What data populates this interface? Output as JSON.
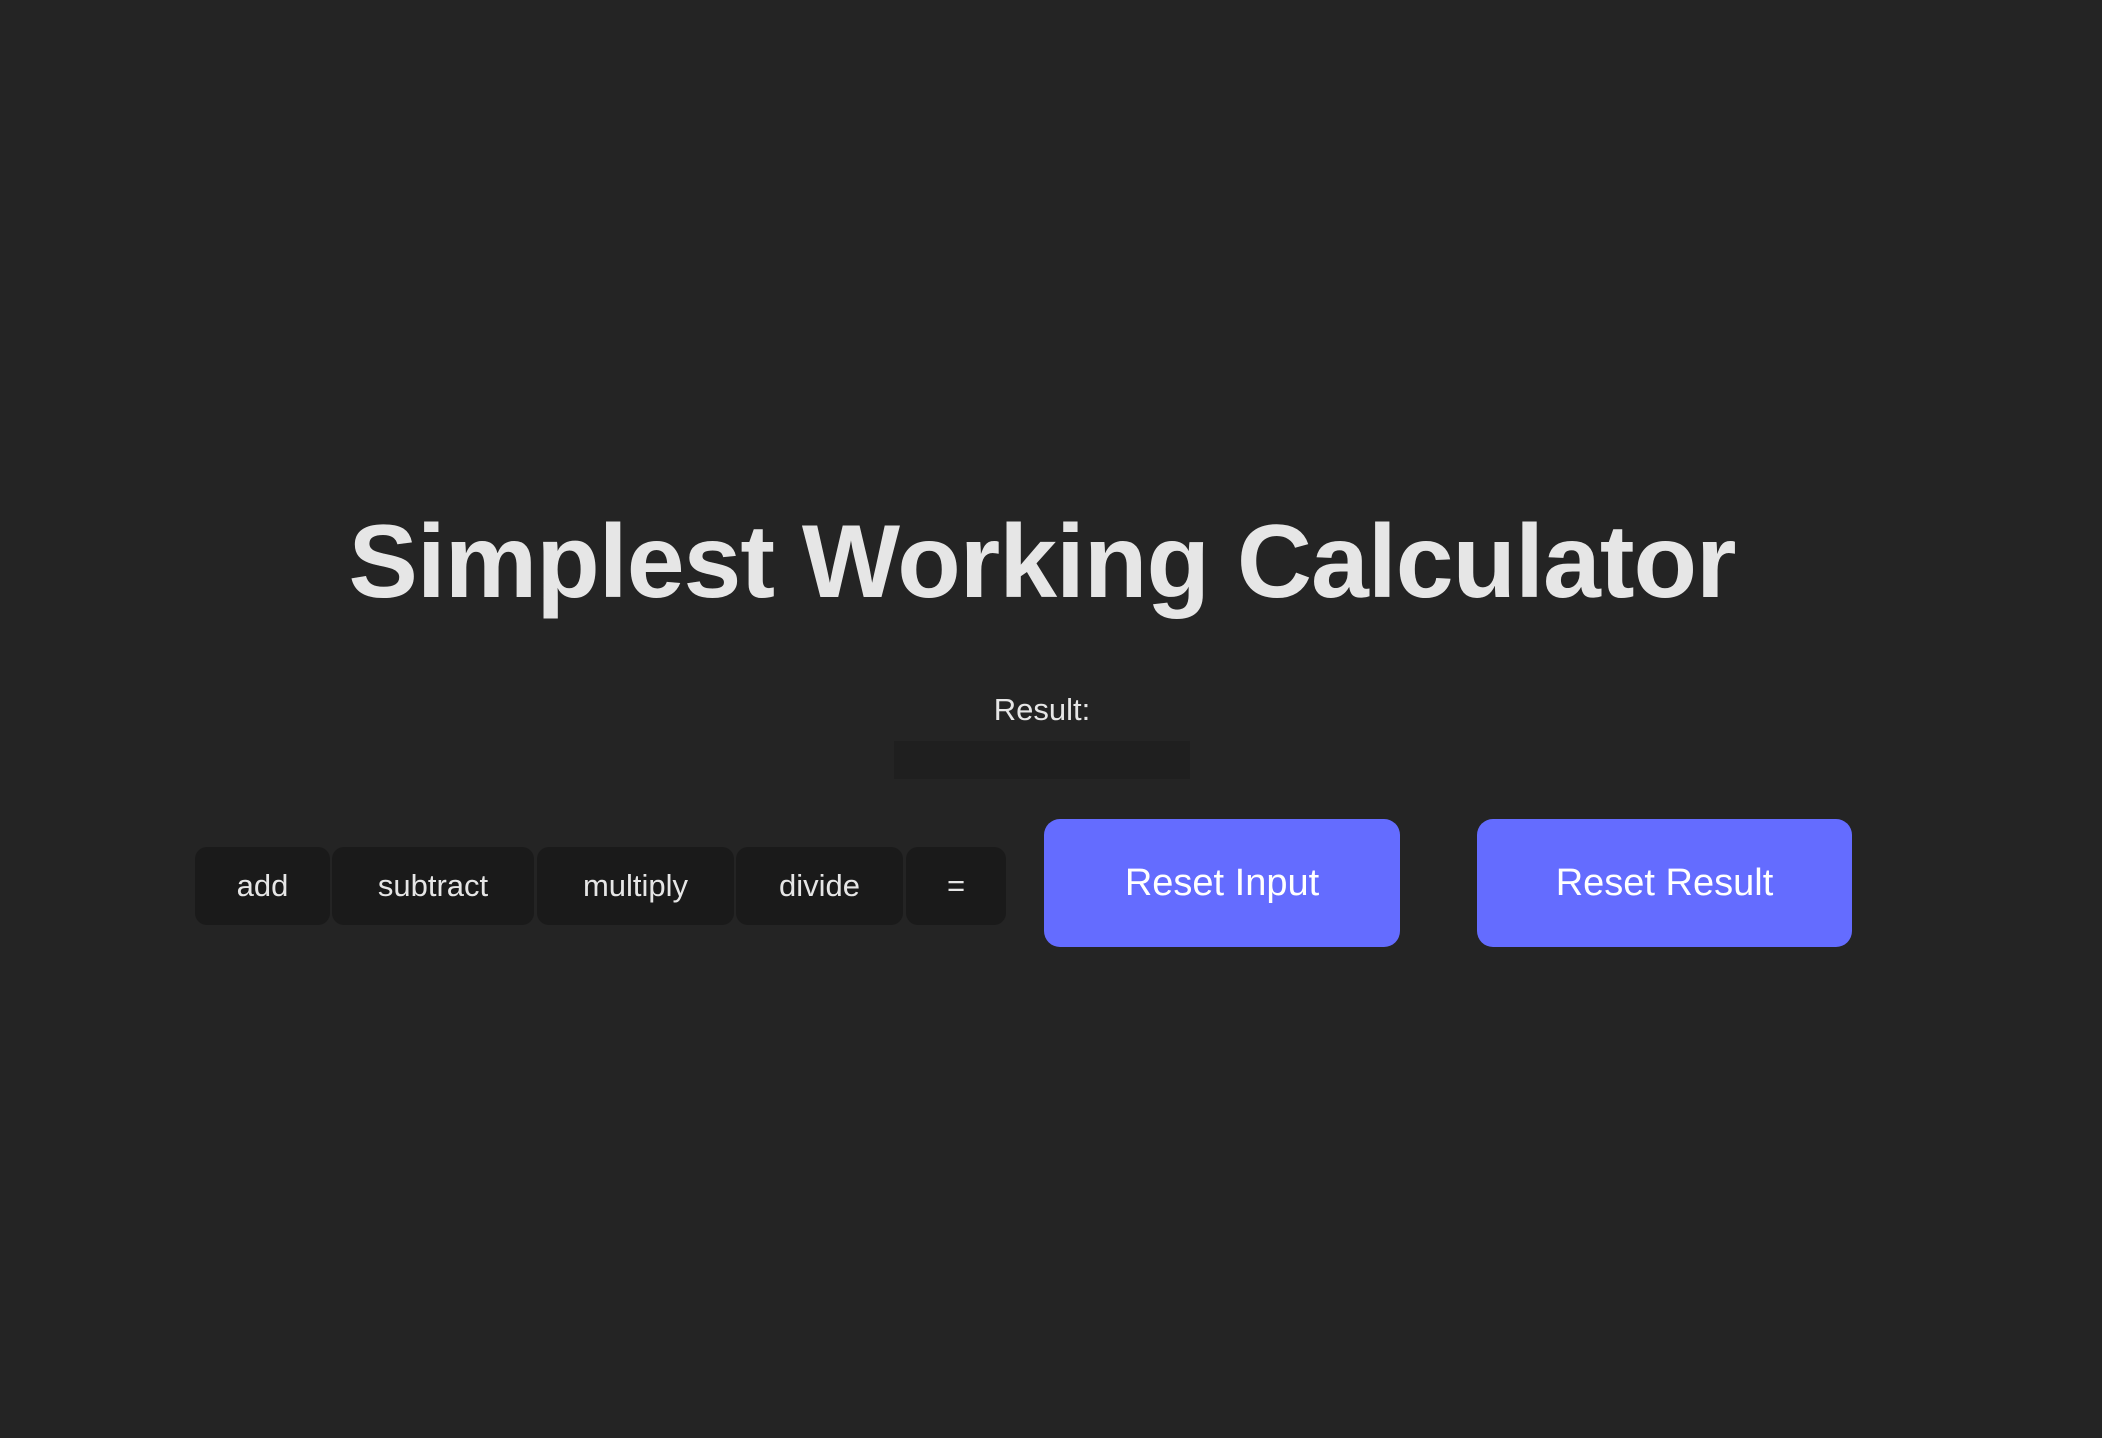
{
  "app": {
    "title": "Simplest Working Calculator"
  },
  "result": {
    "label": "Result:",
    "value": ""
  },
  "operations": {
    "add_label": "add",
    "subtract_label": "subtract",
    "multiply_label": "multiply",
    "divide_label": "divide",
    "equals_label": "="
  },
  "actions": {
    "reset_input_label": "Reset Input",
    "reset_result_label": "Reset Result"
  },
  "colors": {
    "background": "#242424",
    "accent": "#646cff",
    "op_button": "#1a1a1a",
    "text": "#e6e6e6"
  }
}
